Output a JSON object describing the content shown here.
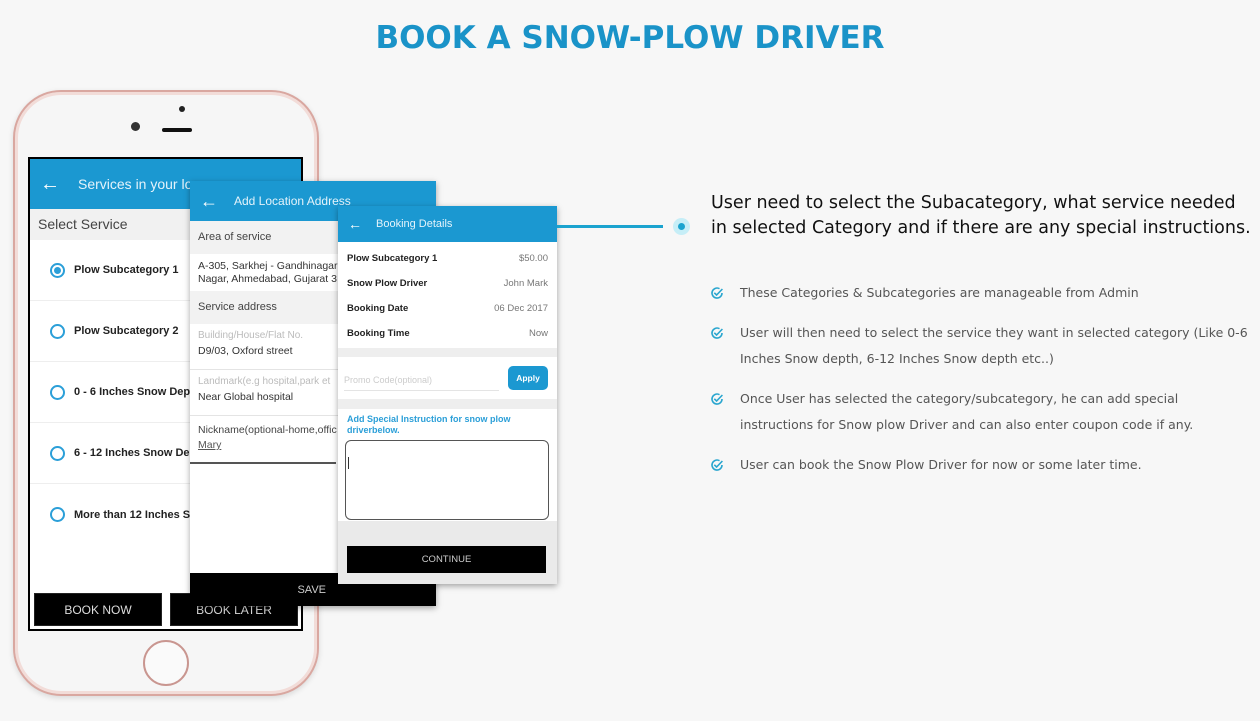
{
  "page": {
    "title": "BOOK A SNOW-PLOW DRIVER",
    "accent_color": "#1a93c8"
  },
  "screen1": {
    "appbar_title": "Services in your loc",
    "section_label": "Select Service",
    "options": [
      {
        "label": "Plow Subcategory 1",
        "selected": true
      },
      {
        "label": "Plow Subcategory 2",
        "selected": false
      },
      {
        "label": "0 - 6 Inches Snow Depth",
        "selected": false
      },
      {
        "label": "6 - 12 Inches Snow Deptl",
        "selected": false
      },
      {
        "label": "More than 12 Inches Sno",
        "selected": false
      }
    ],
    "book_now": "BOOK NOW",
    "book_later": "BOOK LATER"
  },
  "screen2": {
    "appbar_title": "Add Location Address",
    "area_label": "Area of service",
    "area_value_line1": "A-305, Sarkhej - Gandhinagar",
    "area_value_line2": "Nagar, Ahmedabad, Gujarat 3",
    "service_address_label": "Service address",
    "building_placeholder": "Building/House/Flat No.",
    "building_value": "D9/03, Oxford street",
    "landmark_placeholder": "Landmark(e.g hospital,park et",
    "landmark_value": "Near Global hospital",
    "nickname_placeholder": "Nickname(optional-home,offic",
    "nickname_value": "Mary",
    "save": "SAVE"
  },
  "screen3": {
    "appbar_title": "Booking Details",
    "rows": [
      {
        "key": "Plow Subcategory 1",
        "value": "$50.00"
      },
      {
        "key": "Snow Plow Driver",
        "value": "John Mark"
      },
      {
        "key": "Booking Date",
        "value": "06 Dec 2017"
      },
      {
        "key": "Booking Time",
        "value": "Now"
      }
    ],
    "promo_placeholder": "Promo Code(optional)",
    "apply": "Apply",
    "special_label": "Add Special Instruction for snow plow driverbelow.",
    "special_value": "",
    "continue": "CONTINUE"
  },
  "content": {
    "heading": "User need to select the Subacategory, what service needed in selected Category and if there are any special instructions.",
    "features": [
      "These Categories & Subcategories are manageable from Admin",
      "User will then need to select the service they want in selected category (Like 0-6 Inches Snow depth, 6-12 Inches Snow depth etc..)",
      "Once User has selected the category/subcategory, he can add special instructions for Snow plow Driver and can also enter coupon code if any.",
      "User can book the Snow Plow Driver for now or some later time."
    ]
  }
}
